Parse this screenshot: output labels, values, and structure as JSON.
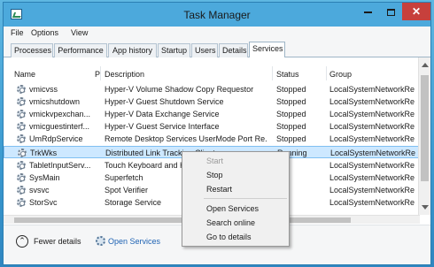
{
  "window": {
    "title": "Task Manager"
  },
  "menu": [
    "File",
    "Options",
    "View"
  ],
  "tabs": [
    "Processes",
    "Performance",
    "App history",
    "Startup",
    "Users",
    "Details",
    "Services"
  ],
  "active_tab": "Services",
  "columns": {
    "name": "Name",
    "pid": "P",
    "description": "Description",
    "status": "Status",
    "group": "Group"
  },
  "services": [
    {
      "name": "vmicvss",
      "description": "Hyper-V Volume Shadow Copy Requestor",
      "status": "Stopped",
      "group": "LocalSystemNetworkRe"
    },
    {
      "name": "vmicshutdown",
      "description": "Hyper-V Guest Shutdown Service",
      "status": "Stopped",
      "group": "LocalSystemNetworkRe"
    },
    {
      "name": "vmickvpexchan...",
      "description": "Hyper-V Data Exchange Service",
      "status": "Stopped",
      "group": "LocalSystemNetworkRe"
    },
    {
      "name": "vmicguestinterf...",
      "description": "Hyper-V Guest Service Interface",
      "status": "Stopped",
      "group": "LocalSystemNetworkRe"
    },
    {
      "name": "UmRdpService",
      "description": "Remote Desktop Services UserMode Port Re...",
      "status": "Stopped",
      "group": "LocalSystemNetworkRe"
    },
    {
      "name": "TrkWks",
      "description": "Distributed Link Tracking Client",
      "status": "Running",
      "group": "LocalSystemNetworkRe"
    },
    {
      "name": "TabletInputServ...",
      "description": "Touch Keyboard and H",
      "status": "",
      "group": "LocalSystemNetworkRe"
    },
    {
      "name": "SysMain",
      "description": "Superfetch",
      "status": "",
      "group": "LocalSystemNetworkRe"
    },
    {
      "name": "svsvc",
      "description": "Spot Verifier",
      "status": "",
      "group": "LocalSystemNetworkRe"
    },
    {
      "name": "StorSvc",
      "description": "Storage Service",
      "status": "",
      "group": "LocalSystemNetworkRe"
    }
  ],
  "selected_service": "TrkWks",
  "context_menu": {
    "start": "Start",
    "stop": "Stop",
    "restart": "Restart",
    "open_services": "Open Services",
    "search_online": "Search online",
    "go_to_details": "Go to details"
  },
  "footer": {
    "fewer_details": "Fewer details",
    "open_services": "Open Services"
  }
}
